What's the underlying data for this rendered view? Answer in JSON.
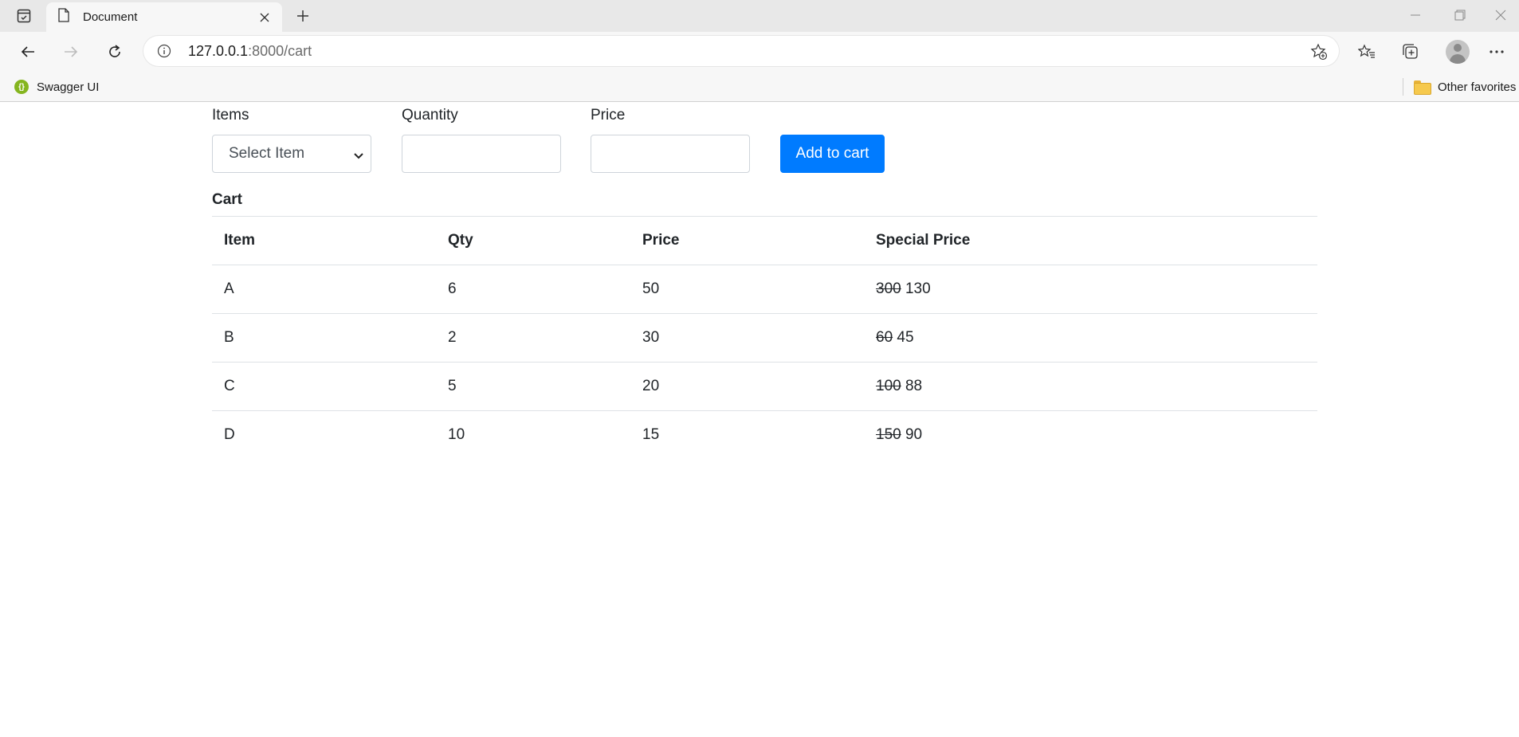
{
  "browser": {
    "tab_title": "Document",
    "url_host": "127.0.0.1",
    "url_path": ":8000/cart",
    "favorites": [
      {
        "label": "Swagger UI",
        "icon": "swagger-icon"
      }
    ],
    "other_favorites_label": "Other favorites"
  },
  "form": {
    "items_label": "Items",
    "items_selected": "Select Item",
    "quantity_label": "Quantity",
    "quantity_value": "",
    "price_label": "Price",
    "price_value": "",
    "add_button_label": "Add to cart"
  },
  "cart": {
    "title": "Cart",
    "columns": [
      "Item",
      "Qty",
      "Price",
      "Special Price"
    ],
    "rows": [
      {
        "item": "A",
        "qty": "6",
        "price": "50",
        "special_old": "300",
        "special_new": "130"
      },
      {
        "item": "B",
        "qty": "2",
        "price": "30",
        "special_old": "60",
        "special_new": "45"
      },
      {
        "item": "C",
        "qty": "5",
        "price": "20",
        "special_old": "100",
        "special_new": "88"
      },
      {
        "item": "D",
        "qty": "10",
        "price": "15",
        "special_old": "150",
        "special_new": "90"
      }
    ]
  },
  "colors": {
    "primary_button": "#007bff",
    "table_border": "#dee2e6",
    "input_border": "#ced4da"
  }
}
